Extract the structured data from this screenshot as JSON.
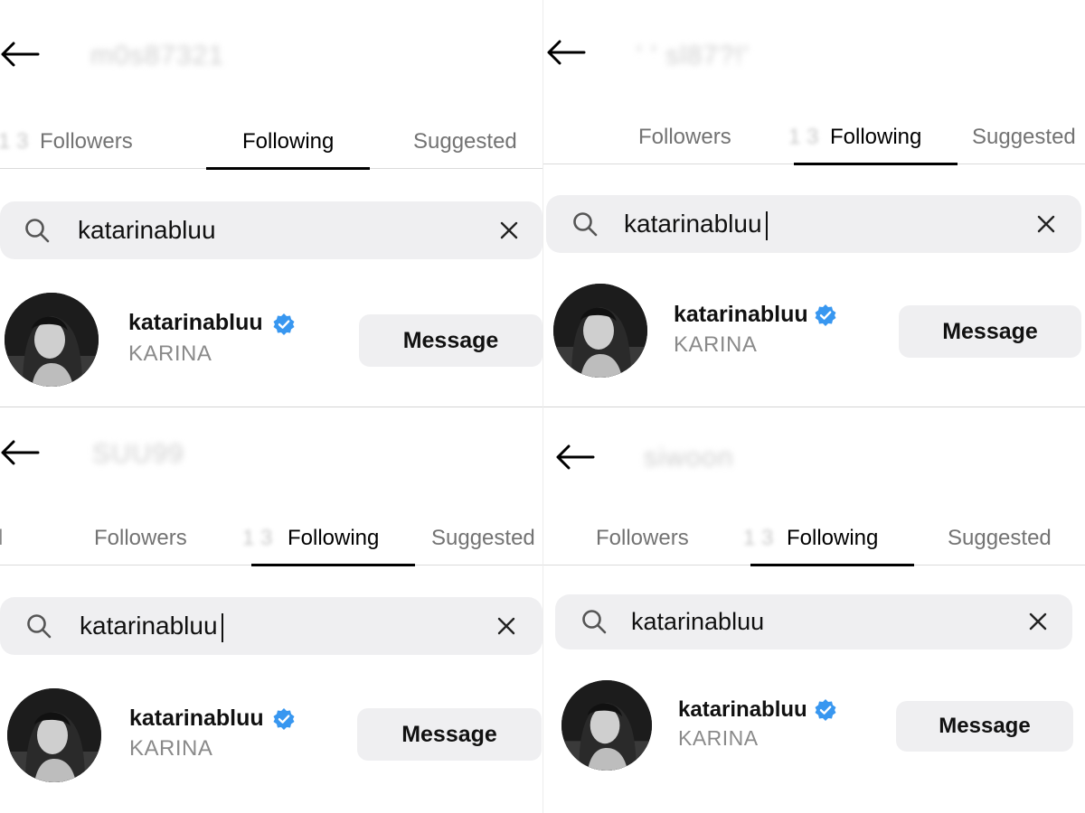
{
  "panels": [
    {
      "header_blurred": "m0s87321",
      "tabs": {
        "followers": "Followers",
        "following": "Following",
        "suggested": "Suggested",
        "active": "following"
      },
      "search": {
        "query": "katarinabluu"
      },
      "result": {
        "username": "katarinabluu",
        "full_name": "KARINA",
        "verified": true,
        "button": "Message"
      }
    },
    {
      "header_blurred": "' ' sl87?!'",
      "tabs": {
        "followers": "Followers",
        "following": "Following",
        "suggested": "Suggested",
        "active": "following"
      },
      "search": {
        "query": "katarinabluu"
      },
      "result": {
        "username": "katarinabluu",
        "full_name": "KARINA",
        "verified": true,
        "button": "Message"
      }
    },
    {
      "header_blurred": "SUU99",
      "tabs": {
        "followers": "Followers",
        "following": "Following",
        "suggested": "Suggested",
        "active": "following"
      },
      "search": {
        "query": "katarinabluu"
      },
      "result": {
        "username": "katarinabluu",
        "full_name": "KARINA",
        "verified": true,
        "button": "Message"
      }
    },
    {
      "header_blurred": "siwoon",
      "tabs": {
        "followers": "Followers",
        "following": "Following",
        "suggested": "Suggested",
        "active": "following"
      },
      "search": {
        "query": "katarinabluu"
      },
      "result": {
        "username": "katarinabluu",
        "full_name": "KARINA",
        "verified": true,
        "button": "Message"
      }
    }
  ],
  "colors": {
    "verified_badge": "#3897f0",
    "search_bg": "#efeff1",
    "button_bg": "#efeff1",
    "muted_text": "#737373"
  },
  "icons": {
    "back": "arrow-left-icon",
    "search": "search-icon",
    "clear": "close-icon",
    "verified": "verified-badge-icon"
  }
}
